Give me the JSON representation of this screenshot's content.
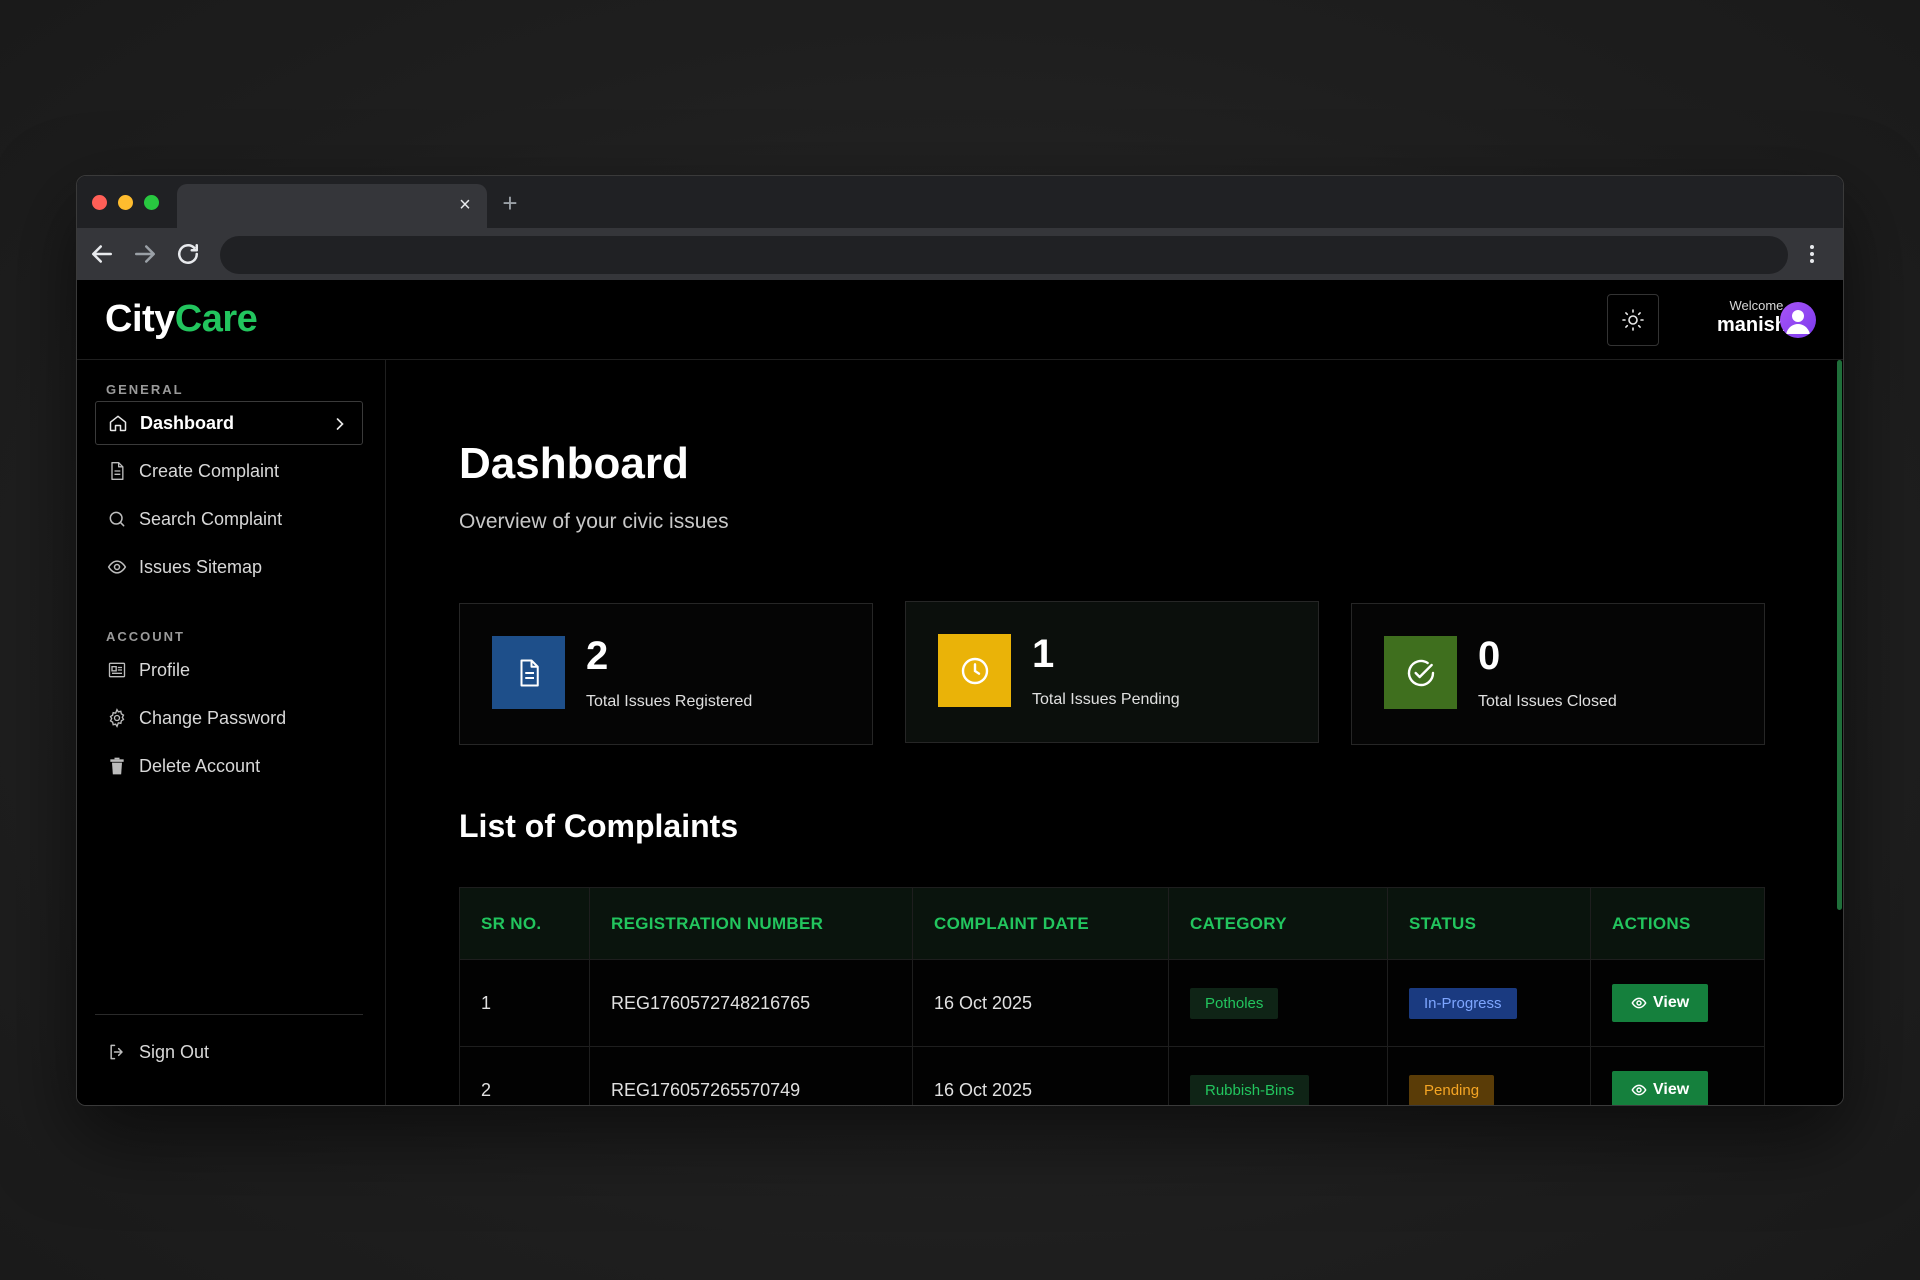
{
  "browser": {
    "tab_close": "×",
    "new_tab": "+"
  },
  "app": {
    "logo_part1": "City",
    "logo_part2": "Care",
    "welcome_label": "Welcome,",
    "user_name": "manish"
  },
  "sidebar": {
    "general_label": "GENERAL",
    "account_label": "ACCOUNT",
    "general_items": [
      {
        "label": "Dashboard",
        "icon": "home-icon",
        "active": true
      },
      {
        "label": "Create Complaint",
        "icon": "document-icon"
      },
      {
        "label": "Search Complaint",
        "icon": "search-icon"
      },
      {
        "label": "Issues Sitemap",
        "icon": "eye-icon"
      }
    ],
    "account_items": [
      {
        "label": "Profile",
        "icon": "id-card-icon"
      },
      {
        "label": "Change Password",
        "icon": "gear-icon"
      },
      {
        "label": "Delete Account",
        "icon": "trash-icon"
      }
    ],
    "sign_out": "Sign Out"
  },
  "main": {
    "title": "Dashboard",
    "subtitle": "Overview of your civic issues",
    "stats": [
      {
        "value": "2",
        "label": "Total Issues Registered",
        "color": "#1e4f8a",
        "icon": "document-icon"
      },
      {
        "value": "1",
        "label": "Total Issues Pending",
        "color": "#eab308",
        "icon": "clock-icon"
      },
      {
        "value": "0",
        "label": "Total Issues Closed",
        "color": "#3f6f1e",
        "icon": "check-circle-icon"
      }
    ],
    "list_title": "List of Complaints",
    "table": {
      "headers": [
        "SR NO.",
        "REGISTRATION NUMBER",
        "COMPLAINT DATE",
        "CATEGORY",
        "STATUS",
        "ACTIONS"
      ],
      "rows": [
        {
          "sr": "1",
          "reg": "REG1760572748216765",
          "date": "16 Oct 2025",
          "category": "Potholes",
          "status": "In-Progress",
          "action": "View"
        },
        {
          "sr": "2",
          "reg": "REG176057265570749",
          "date": "16 Oct 2025",
          "category": "Rubbish-Bins",
          "status": "Pending",
          "action": "View"
        }
      ]
    }
  }
}
